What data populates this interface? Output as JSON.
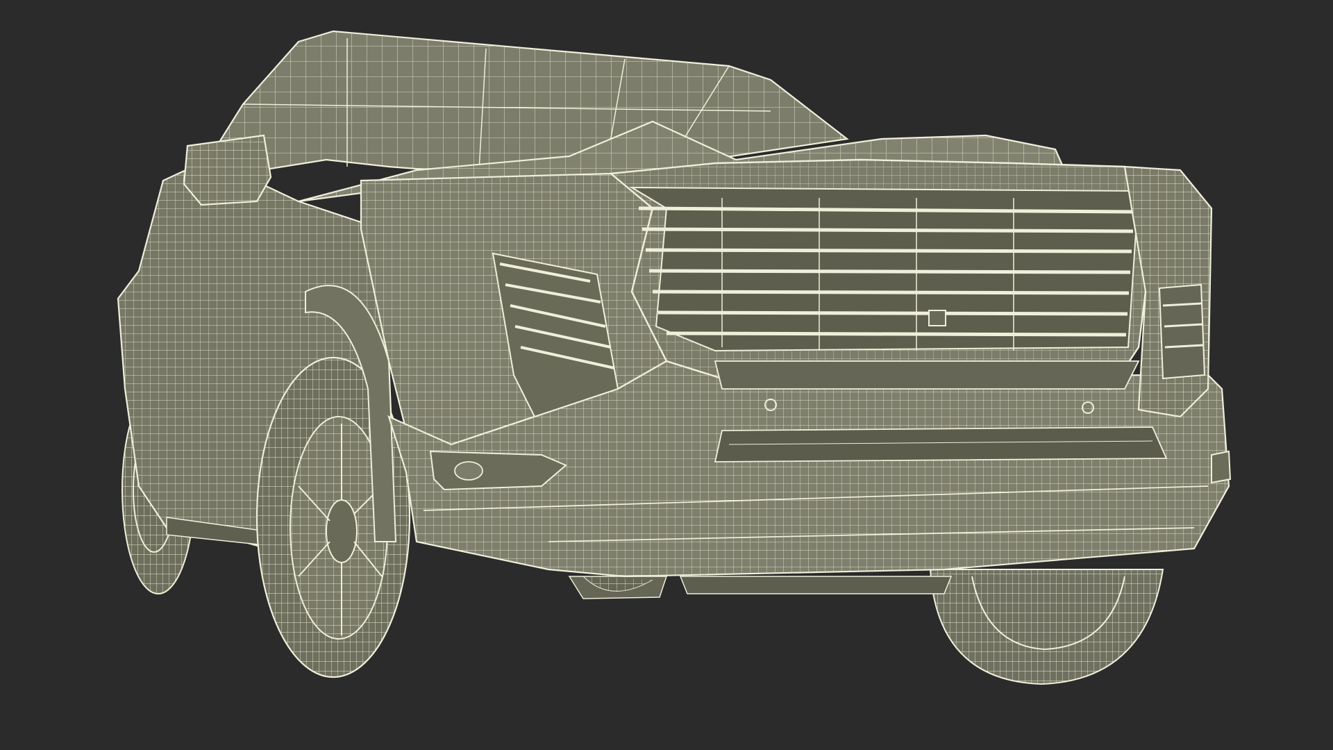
{
  "scene": {
    "subject": "wireframe-suv-front",
    "colors": {
      "background": "#2b2b2b",
      "body": "#7e7e6c",
      "body_dark": "#6c6c5b",
      "wire": "#efefdc",
      "shadow": "#5a5a4a"
    }
  }
}
